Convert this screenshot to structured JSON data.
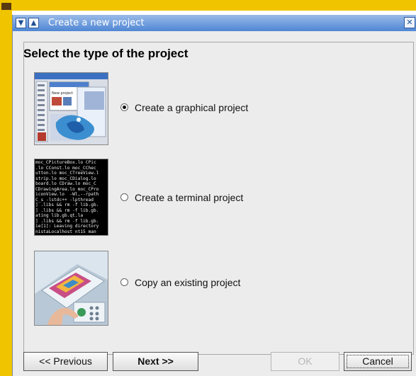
{
  "window": {
    "title": "Create a new project",
    "collapse_icon": "chevron-down-icon",
    "pin_icon": "arrow-up-icon",
    "close_icon": "close-icon"
  },
  "heading": "Select the type of the project",
  "options": [
    {
      "label": "Create a graphical project",
      "checked": true,
      "image": "graphical-project-thumbnail"
    },
    {
      "label": "Create a terminal project",
      "checked": false,
      "image": "terminal-project-thumbnail"
    },
    {
      "label": "Copy an existing project",
      "checked": false,
      "image": "copy-project-thumbnail"
    }
  ],
  "terminal_lines": [
    "moc_CPictureBox.lo CPic",
    ".lo CConst.lo moc_CChec",
    "utton.lo moc_CTreeView.l",
    "strip.lo moc_CDialog.lo",
    "board.lo CDraw.lo moc_C",
    "CDrawingArea.lo moc_CPro",
    "iconView.lo  -Wl,--rpath",
    "C_s -lstdc++ -lpthread",
    "] .libs && rm -f lib.gb.",
    "] .libs && rm -f lib.gb.",
    "ating lib.gb.qt.la",
    "] .libs && rm -f lib.gb.",
    "ie[1]: Leaving directory",
    "nistaLocalhost nt15 man"
  ],
  "buttons": {
    "previous": "<< Previous",
    "next": "Next >>",
    "ok": "OK",
    "cancel": "Cancel"
  },
  "colors": {
    "desktop": "#f1c400",
    "titlebar": "#4f86d4",
    "dialog": "#ececec"
  }
}
